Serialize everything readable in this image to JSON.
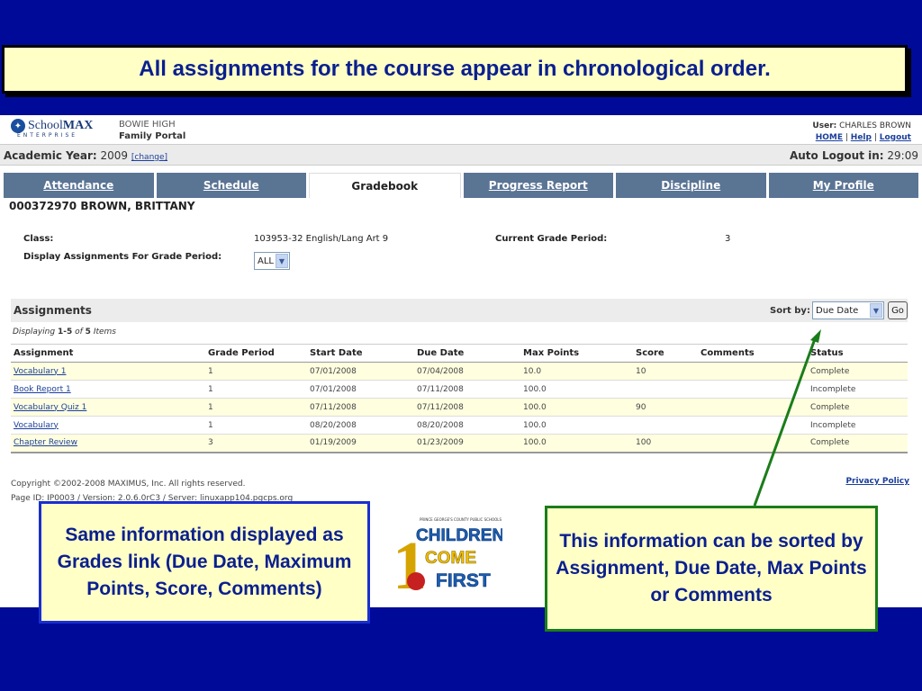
{
  "slide": {
    "title": "All assignments for the course appear in chronological order.",
    "callout_left": "Same information displayed as Grades link (Due Date, Maximum Points, Score, Comments)",
    "callout_right": "This information can be sorted by Assignment, Due Date, Max Points or Comments"
  },
  "header": {
    "logo_school": "School",
    "logo_max": "MAX",
    "logo_sub": "ENTERPRISE",
    "school_name": "BOWIE HIGH",
    "portal": "Family Portal",
    "user_label": "User:",
    "user_name": "CHARLES BROWN",
    "links": [
      "HOME",
      "Help",
      "Logout"
    ]
  },
  "yearbar": {
    "label": "Academic Year:",
    "year": "2009",
    "change": "[change]",
    "logout_label": "Auto Logout in:",
    "logout_time": "29:09"
  },
  "tabs": [
    "Attendance",
    "Schedule",
    "Gradebook",
    "Progress Report",
    "Discipline",
    "My Profile"
  ],
  "student": "000372970 BROWN, BRITTANY",
  "class_info": {
    "class_label": "Class:",
    "class_value": "103953-32 English/Lang Art 9",
    "period_label": "Current Grade Period:",
    "period_value": "3",
    "display_label": "Display Assignments For Grade Period:",
    "display_value": "ALL"
  },
  "assignments": {
    "title": "Assignments",
    "sort_label": "Sort by:",
    "sort_value": "Due Date",
    "go": "Go",
    "displaying_prefix": "Displaying",
    "displaying_range": "1-5",
    "displaying_of": "of",
    "displaying_total": "5",
    "displaying_suffix": "Items",
    "columns": [
      "Assignment",
      "Grade Period",
      "Start Date",
      "Due Date",
      "Max Points",
      "Score",
      "Comments",
      "Status"
    ],
    "rows": [
      [
        "Vocabulary 1",
        "1",
        "07/01/2008",
        "07/04/2008",
        "10.0",
        "10",
        "",
        "Complete"
      ],
      [
        "Book Report 1",
        "1",
        "07/01/2008",
        "07/11/2008",
        "100.0",
        "",
        "",
        "Incomplete"
      ],
      [
        "Vocabulary Quiz 1",
        "1",
        "07/11/2008",
        "07/11/2008",
        "100.0",
        "90",
        "",
        "Complete"
      ],
      [
        "Vocabulary",
        "1",
        "08/20/2008",
        "08/20/2008",
        "100.0",
        "",
        "",
        "Incomplete"
      ],
      [
        "Chapter Review",
        "3",
        "01/19/2009",
        "01/23/2009",
        "100.0",
        "100",
        "",
        "Complete"
      ]
    ]
  },
  "footer": {
    "copyright": "Copyright ©2002-2008 MAXIMUS, Inc. All rights reserved.",
    "page_id": "Page ID: IP0003 / Version: 2.0.6.0rC3 / Server: linuxapp104.pgcps.org",
    "privacy": "Privacy Policy"
  },
  "logo2": {
    "top": "PRINCE GEORGE'S COUNTY PUBLIC SCHOOLS",
    "children": "CHILDREN",
    "come": "COME",
    "first": "FIRST",
    "one": "1"
  },
  "colors": {
    "slide_bg": "#000a99",
    "callout_bg": "#ffffc6",
    "tab_bg": "#5a7494",
    "arrow": "#1a7d1a"
  }
}
